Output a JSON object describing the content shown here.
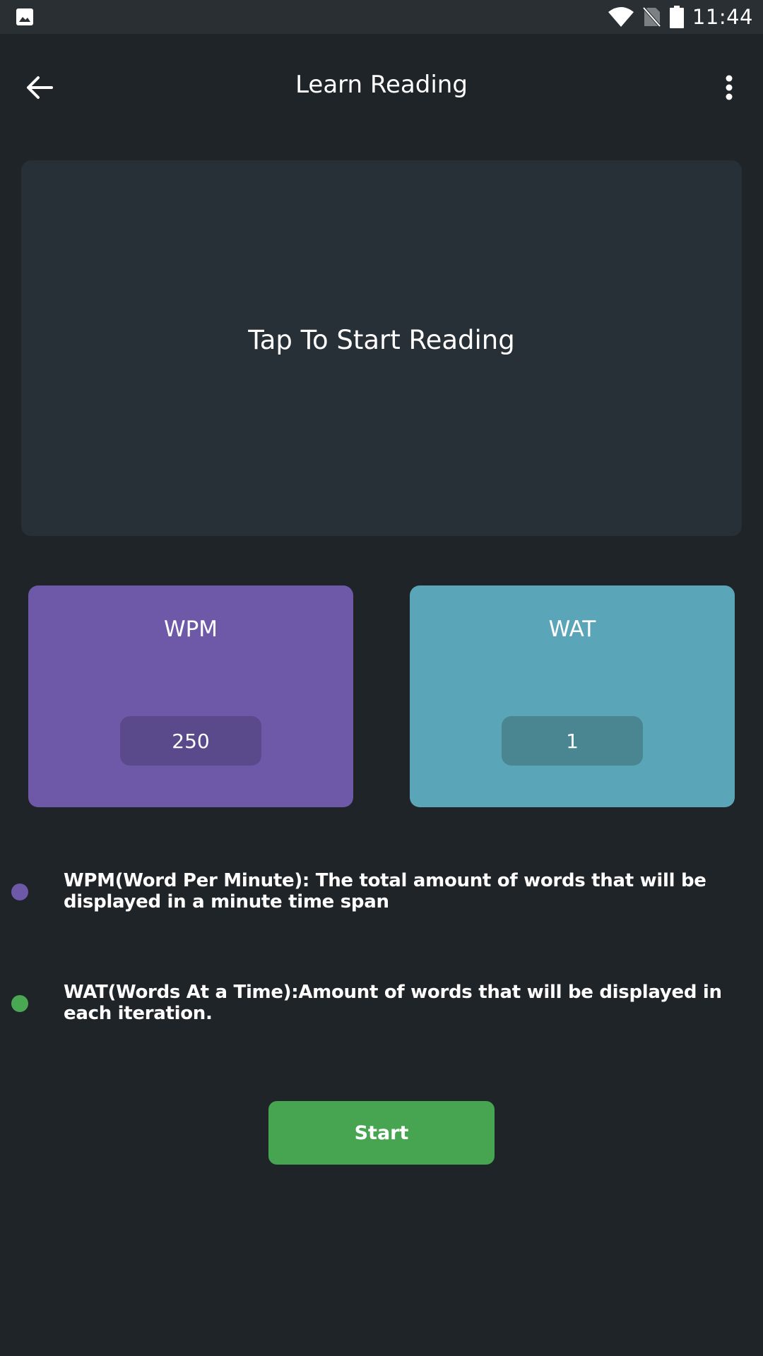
{
  "status_bar": {
    "time": "11:44",
    "icons": [
      "gallery-icon",
      "wifi-icon",
      "no-sim-icon",
      "battery-icon"
    ]
  },
  "app_bar": {
    "title": "Learn Reading",
    "back_icon": "arrow-back-icon",
    "menu_icon": "more-vert-icon"
  },
  "reading_panel": {
    "prompt": "Tap To Start Reading"
  },
  "settings": {
    "wpm": {
      "label": "WPM",
      "value": "250",
      "color": "#6e59a8"
    },
    "wat": {
      "label": "WAT",
      "value": "1",
      "color": "#5ba5b8"
    }
  },
  "info": {
    "wpm_text": "WPM(Word Per Minute): The total amount of words that will be displayed in a minute time span",
    "wat_text": "WAT(Words At a Time):Amount of words that will be displayed in each iteration.",
    "wpm_dot_color": "#6e59a8",
    "wat_dot_color": "#4aa853"
  },
  "start_button": {
    "label": "Start",
    "color": "#47a552"
  }
}
